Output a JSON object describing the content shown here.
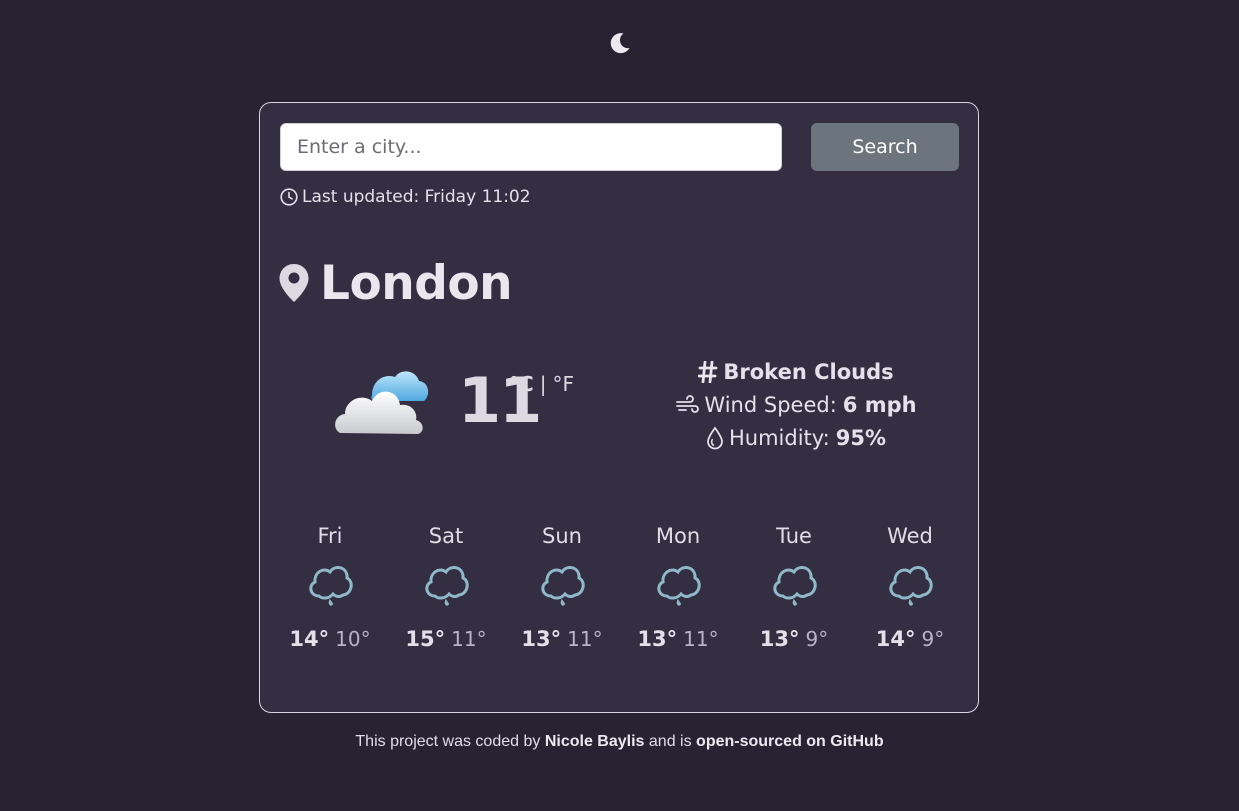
{
  "theme_toggle": {
    "icon": "moon-icon"
  },
  "search": {
    "placeholder": "Enter a city...",
    "value": "",
    "button_label": "Search"
  },
  "last_updated": {
    "icon": "clock-icon",
    "label": "Last updated:",
    "value": "Friday 11:02"
  },
  "city": {
    "icon": "location-pin-icon",
    "name": "London"
  },
  "current": {
    "icon": "cloud-icon",
    "temperature": "11",
    "unit_celsius": "°C",
    "unit_separator": "|",
    "unit_fahrenheit": "°F",
    "description_icon": "hash-icon",
    "description": "Broken Clouds",
    "wind_icon": "wind-icon",
    "wind_label": "Wind Speed:",
    "wind_value": "6 mph",
    "humidity_icon": "droplet-icon",
    "humidity_label": "Humidity:",
    "humidity_value": "95%"
  },
  "forecast": [
    {
      "day": "Fri",
      "icon": "rain-cloud-icon",
      "max": "14°",
      "min": "10°"
    },
    {
      "day": "Sat",
      "icon": "rain-cloud-icon",
      "max": "15°",
      "min": "11°"
    },
    {
      "day": "Sun",
      "icon": "rain-cloud-icon",
      "max": "13°",
      "min": "11°"
    },
    {
      "day": "Mon",
      "icon": "rain-cloud-icon",
      "max": "13°",
      "min": "11°"
    },
    {
      "day": "Tue",
      "icon": "rain-cloud-icon",
      "max": "13°",
      "min": "9°"
    },
    {
      "day": "Wed",
      "icon": "rain-cloud-icon",
      "max": "14°",
      "min": "9°"
    }
  ],
  "footer": {
    "prefix": "This project was coded by",
    "author": "Nicole Baylis",
    "middle": "and is",
    "link": "open-sourced on GitHub"
  },
  "colors": {
    "background": "#272333",
    "card": "#342e43",
    "button": "#6c757d",
    "forecast_icon": "#8fb8c9"
  }
}
